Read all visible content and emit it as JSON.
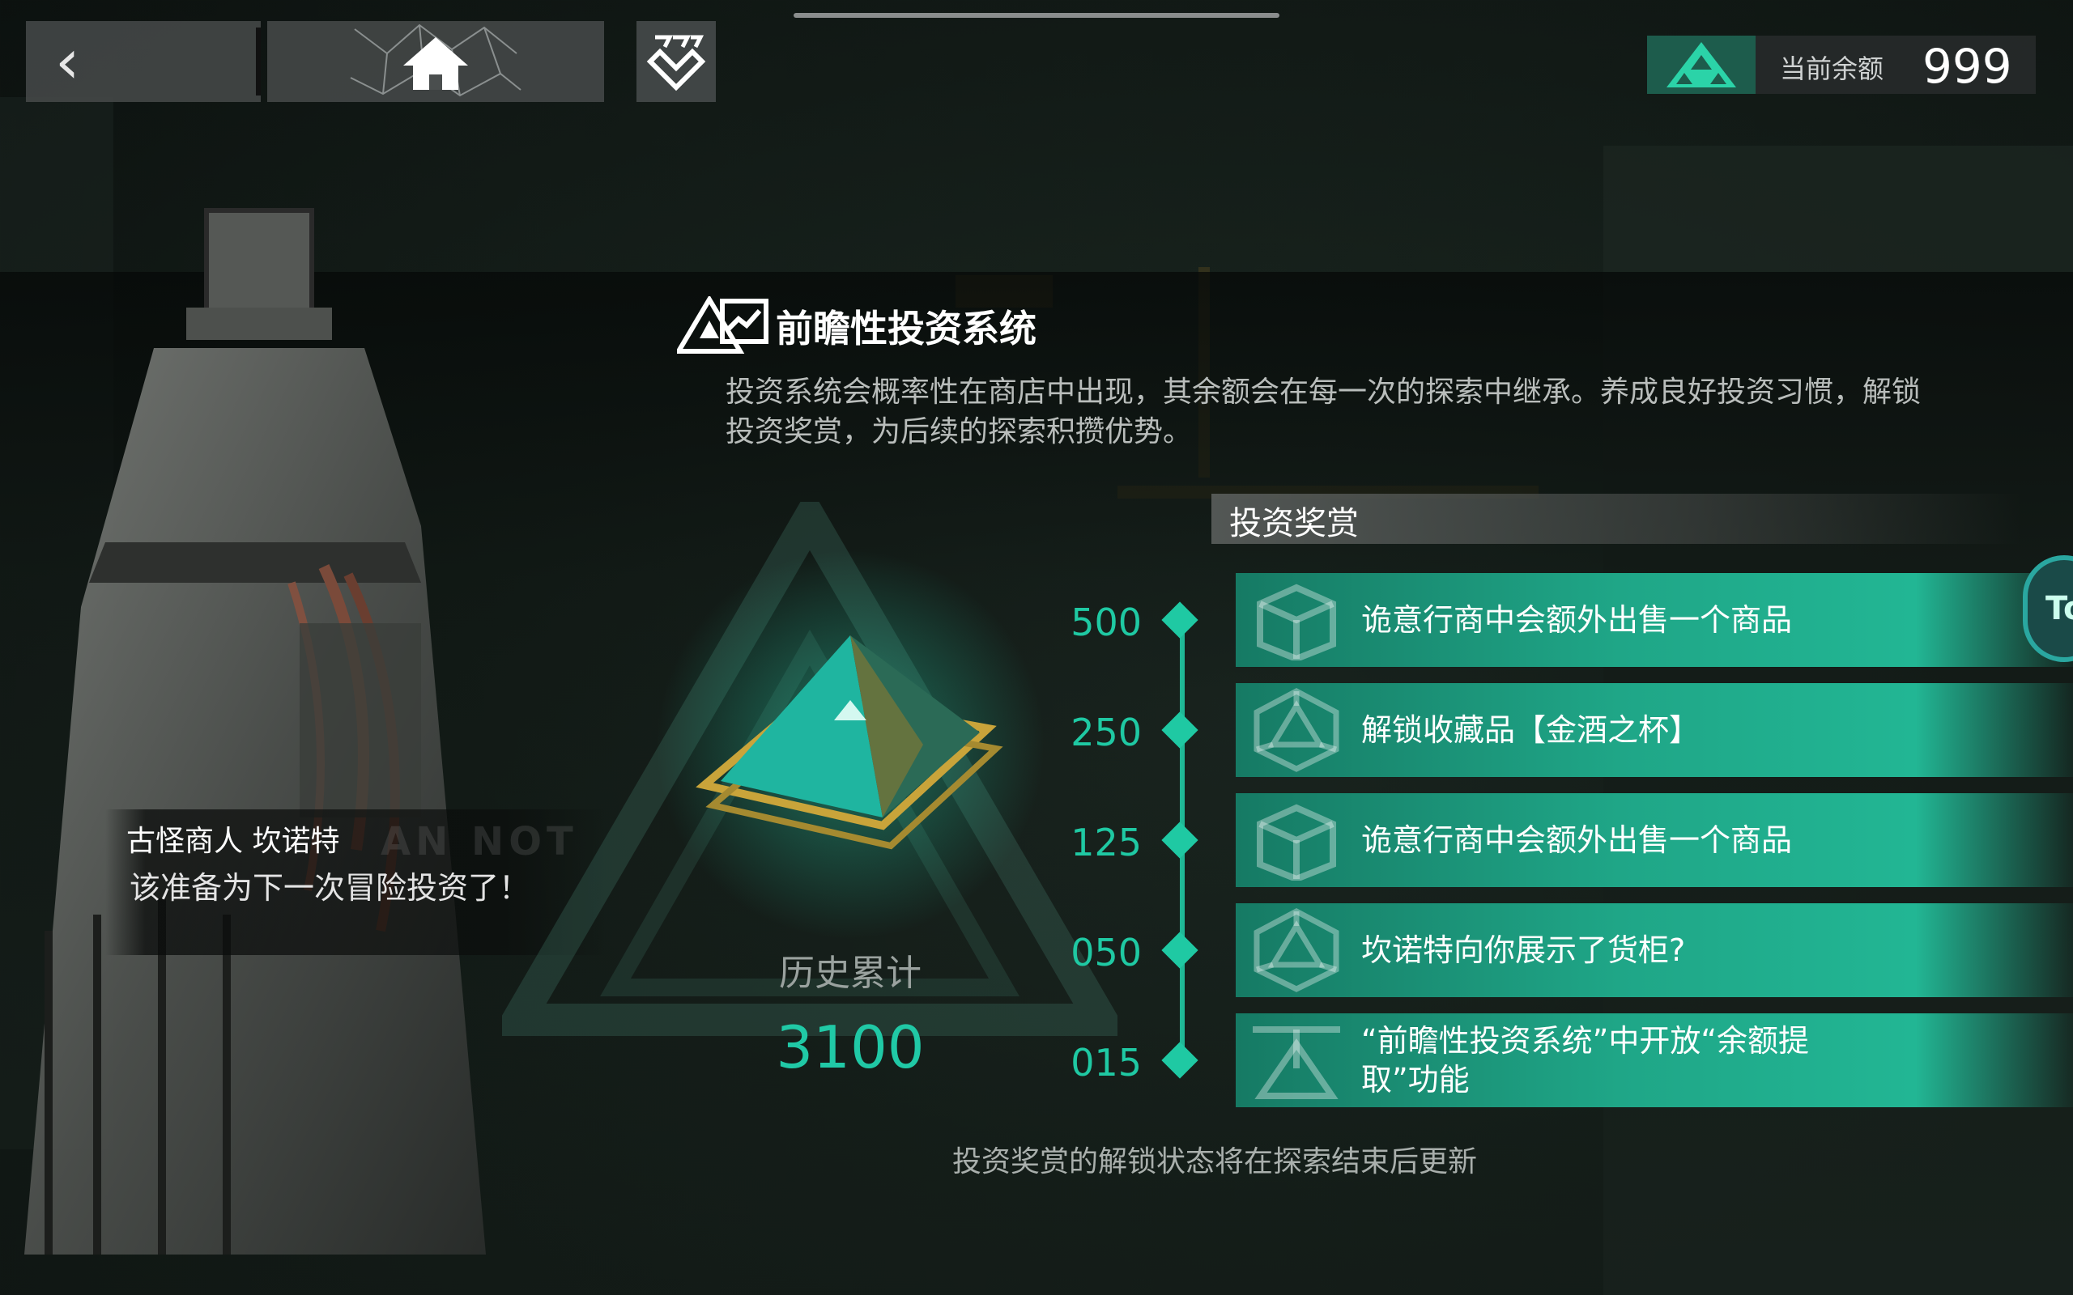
{
  "header": {
    "balance_label": "当前余额",
    "balance_value": "999"
  },
  "panel": {
    "title": "前瞻性投资系统",
    "description": "投资系统会概率性在商店中出现，其余额会在每一次的探索中继承。养成良好投资习惯，解锁投资奖赏，为后续的探索积攒优势。"
  },
  "npc": {
    "name": "古怪商人 坎诺特",
    "line": "该准备为下一次冒险投资了！",
    "deco": "AN NOT"
  },
  "history": {
    "label": "历史累计",
    "value": "3100"
  },
  "rewards": {
    "header": "投资奖赏",
    "items": [
      {
        "threshold": "500",
        "text": "诡意行商中会额外出售一个商品",
        "icon": "box-icon"
      },
      {
        "threshold": "250",
        "text": "解锁收藏品【金酒之杯】",
        "icon": "d20-icon"
      },
      {
        "threshold": "125",
        "text": "诡意行商中会额外出售一个商品",
        "icon": "box-icon"
      },
      {
        "threshold": "050",
        "text": "坎诺特向你展示了货柜?",
        "icon": "d20-icon"
      },
      {
        "threshold": "015",
        "text": "“前瞻性投资系统”中开放“余额提取”功能",
        "icon": "withdraw-icon"
      }
    ]
  },
  "footer_note": "投资奖赏的解锁状态将在探索结束后更新",
  "side_toggle_label": "To",
  "colors": {
    "accent": "#1fc9a3",
    "row": "#1fa687"
  }
}
